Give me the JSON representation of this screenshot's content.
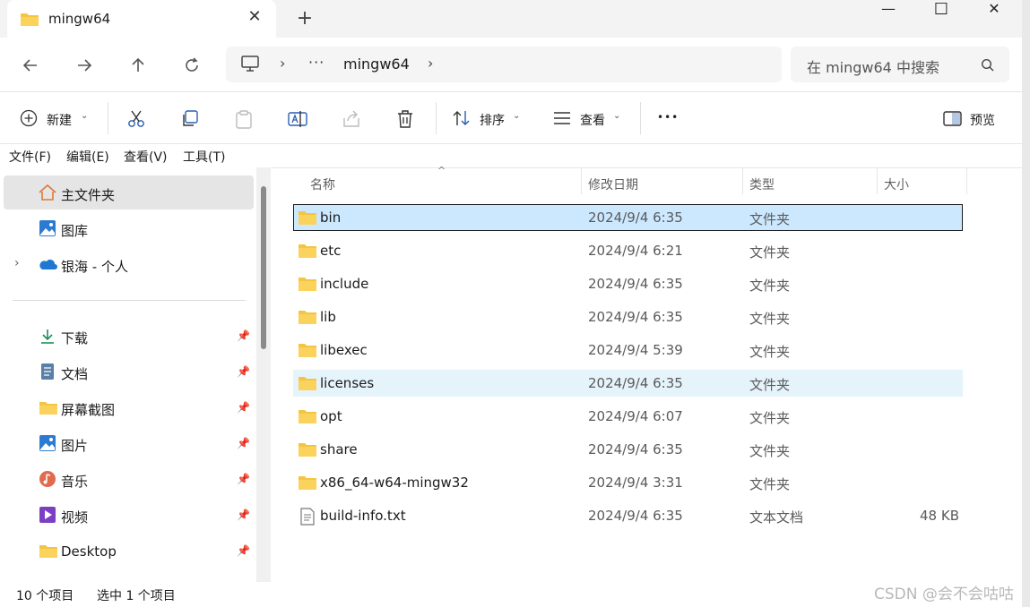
{
  "window": {
    "tab_title": "mingw64",
    "close_tab": "✕",
    "new_tab": "+",
    "minimize": "—",
    "maximize": "☐",
    "close": "✕"
  },
  "address": {
    "computer_icon": "computer-icon",
    "ellipsis": "···",
    "current": "mingw64",
    "search_placeholder": "在 mingw64 中搜索"
  },
  "toolbar": {
    "new_label": "新建",
    "sort_label": "排序",
    "view_label": "查看",
    "more_label": "•••",
    "preview_label": "预览"
  },
  "menu": [
    "文件(F)",
    "编辑(E)",
    "查看(V)",
    "工具(T)"
  ],
  "sidebar": {
    "top": [
      {
        "label": "主文件夹",
        "icon": "home-icon"
      },
      {
        "label": "图库",
        "icon": "gallery-icon"
      },
      {
        "label": "银海 - 个人",
        "icon": "onedrive-icon"
      }
    ],
    "quick": [
      {
        "label": "下载",
        "icon": "download-icon"
      },
      {
        "label": "文档",
        "icon": "document-icon"
      },
      {
        "label": "屏幕截图",
        "icon": "folder-icon"
      },
      {
        "label": "图片",
        "icon": "pictures-icon"
      },
      {
        "label": "音乐",
        "icon": "music-icon"
      },
      {
        "label": "视频",
        "icon": "video-icon"
      },
      {
        "label": "Desktop",
        "icon": "folder-icon"
      }
    ]
  },
  "columns": {
    "name": "名称",
    "modified": "修改日期",
    "type": "类型",
    "size": "大小"
  },
  "files": [
    {
      "name": "bin",
      "date": "2024/9/4 6:35",
      "type": "文件夹",
      "size": ""
    },
    {
      "name": "etc",
      "date": "2024/9/4 6:21",
      "type": "文件夹",
      "size": ""
    },
    {
      "name": "include",
      "date": "2024/9/4 6:35",
      "type": "文件夹",
      "size": ""
    },
    {
      "name": "lib",
      "date": "2024/9/4 6:35",
      "type": "文件夹",
      "size": ""
    },
    {
      "name": "libexec",
      "date": "2024/9/4 5:39",
      "type": "文件夹",
      "size": ""
    },
    {
      "name": "licenses",
      "date": "2024/9/4 6:35",
      "type": "文件夹",
      "size": ""
    },
    {
      "name": "opt",
      "date": "2024/9/4 6:07",
      "type": "文件夹",
      "size": ""
    },
    {
      "name": "share",
      "date": "2024/9/4 6:35",
      "type": "文件夹",
      "size": ""
    },
    {
      "name": "x86_64-w64-mingw32",
      "date": "2024/9/4 3:31",
      "type": "文件夹",
      "size": ""
    },
    {
      "name": "build-info.txt",
      "date": "2024/9/4 6:35",
      "type": "文本文档",
      "size": "48 KB"
    }
  ],
  "status": {
    "count": "10 个项目",
    "selected": "选中 1 个项目"
  },
  "watermark": "CSDN @会不会咕咕"
}
